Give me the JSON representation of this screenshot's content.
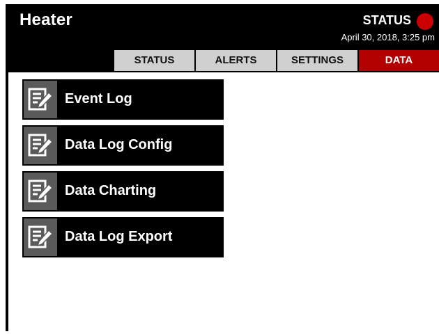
{
  "header": {
    "title": "Heater",
    "status_label": "STATUS",
    "status_indicator_color": "#cc0000",
    "datetime": "April 30, 2018, 3:25 pm"
  },
  "tabs": [
    {
      "label": "STATUS",
      "active": false
    },
    {
      "label": "ALERTS",
      "active": false
    },
    {
      "label": "SETTINGS",
      "active": false
    },
    {
      "label": "DATA",
      "active": true
    }
  ],
  "menu": {
    "items": [
      {
        "label": "Event Log",
        "icon": "notepad-pencil-icon"
      },
      {
        "label": "Data Log Config",
        "icon": "notepad-pencil-icon"
      },
      {
        "label": "Data Charting",
        "icon": "notepad-pencil-icon"
      },
      {
        "label": "Data Log Export",
        "icon": "notepad-pencil-icon"
      }
    ]
  },
  "colors": {
    "header_bg": "#000000",
    "active_tab": "#b30000",
    "inactive_tab": "#d0d0d0",
    "icon_box": "#5a5a5a"
  }
}
